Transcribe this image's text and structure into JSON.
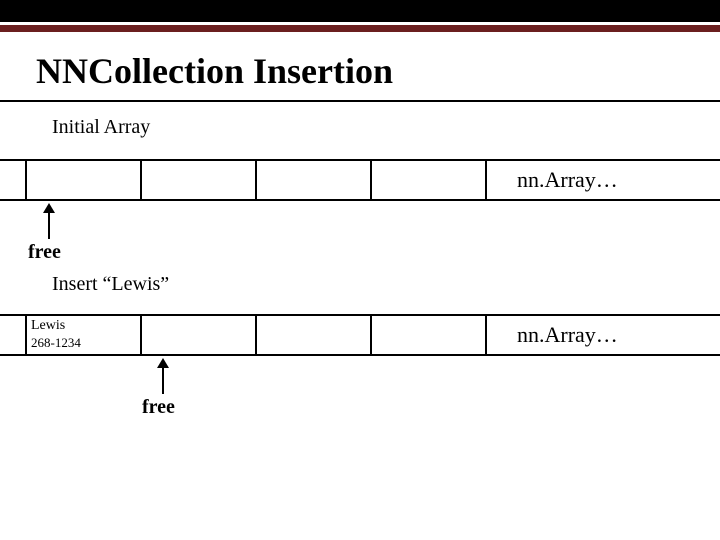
{
  "title": "NNCollection Insertion",
  "section1": {
    "caption": "Initial Array",
    "trail": "nn.Array…",
    "arrow_label": "free"
  },
  "section2": {
    "caption": "Insert “Lewis”",
    "trail": "nn.Array…",
    "arrow_label": "free",
    "cell0_name": "Lewis",
    "cell0_num": "268-1234"
  }
}
